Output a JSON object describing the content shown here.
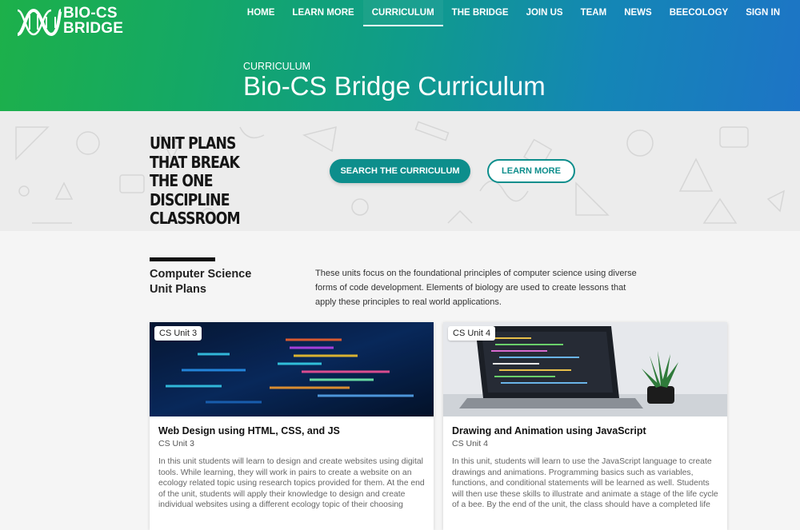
{
  "brand": {
    "line1": "BIO-CS",
    "line2": "BRIDGE"
  },
  "nav": {
    "items": [
      {
        "label": "HOME"
      },
      {
        "label": "LEARN MORE"
      },
      {
        "label": "CURRICULUM",
        "active": true
      },
      {
        "label": "THE BRIDGE"
      },
      {
        "label": "JOIN US"
      },
      {
        "label": "TEAM"
      },
      {
        "label": "NEWS"
      },
      {
        "label": "BEECOLOGY"
      },
      {
        "label": "SIGN IN"
      }
    ]
  },
  "hero": {
    "eyebrow": "CURRICULUM",
    "title": "Bio-CS Bridge Curriculum"
  },
  "band": {
    "heading": "UNIT PLANS THAT BREAK THE ONE DISCIPLINE CLASSROOM",
    "primary_button": "SEARCH THE CURRICULUM",
    "secondary_button": "LEARN MORE"
  },
  "section": {
    "title_line1": "Computer Science",
    "title_line2": "Unit Plans",
    "description": "These units focus on the foundational principles of computer science using diverse forms of code development. Elements of biology are used to create lessons that apply these principles to real world applications."
  },
  "cards": [
    {
      "badge": "CS Unit 3",
      "title": "Web Design using HTML, CSS, and JS",
      "subtitle": "CS Unit 3",
      "body": "In this unit students will learn to design and create websites using digital tools. While learning, they will work in pairs to create a website on an ecology related topic using research topics provided for them. At the end of the unit, students will apply their knowledge to design and create individual websites using a different ecology topic of their choosing",
      "image": "code-on-screen-image"
    },
    {
      "badge": "CS Unit 4",
      "title": "Drawing and Animation using JavaScript",
      "subtitle": "CS Unit 4",
      "body": "In this unit, students will learn to use the JavaScript language to create drawings and animations. Programming basics such as variables, functions, and conditional statements will be learned as well. Students will then use these skills to illustrate and animate a stage of the life cycle of a bee. By the end of the unit, the class should have a completed life",
      "image": "laptop-with-plant-image"
    }
  ],
  "colors": {
    "header_gradient_start": "#1db04a",
    "header_gradient_end": "#1d74c6",
    "teal_accent": "#0d8e8c"
  }
}
